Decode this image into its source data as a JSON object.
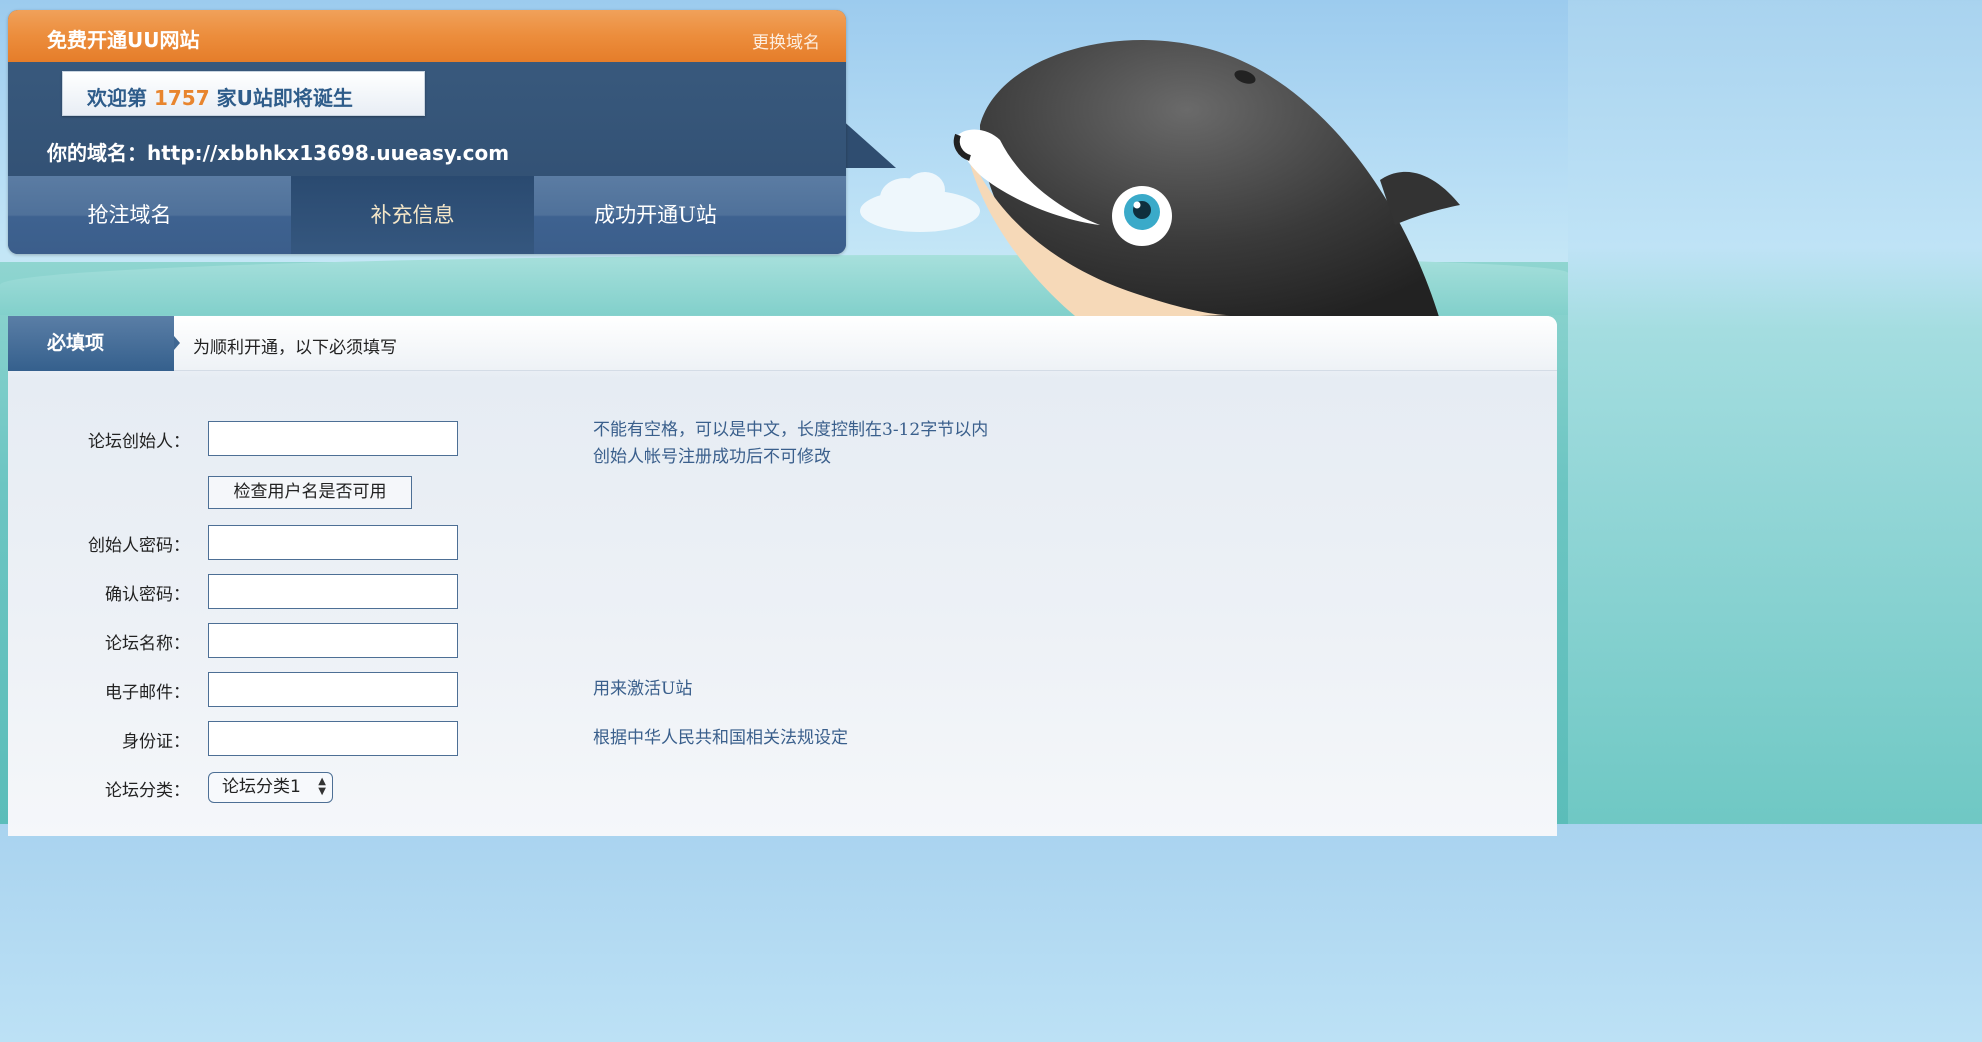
{
  "header": {
    "title": "免费开通UU网站",
    "change_domain": "更换域名",
    "welcome_prefix": "欢迎第 ",
    "welcome_count": "1757",
    "welcome_suffix": " 家U站即将诞生",
    "domain_label": "你的域名：",
    "domain_value": "http://xbbhkx13698.uueasy.com"
  },
  "steps": [
    {
      "label": "抢注域名",
      "active": false
    },
    {
      "label": "补充信息",
      "active": true
    },
    {
      "label": "成功开通U站",
      "active": false
    }
  ],
  "form": {
    "section_tab": "必填项",
    "section_desc": "为顺利开通，以下必须填写",
    "founder_label": "论坛创始人：",
    "founder_value": "",
    "founder_hint_1": "不能有空格，可以是中文，长度控制在3-12字节以内",
    "founder_hint_2": "创始人帐号注册成功后不可修改",
    "check_button": "检查用户名是否可用",
    "password_label": "创始人密码：",
    "password_value": "",
    "confirm_label": "确认密码：",
    "confirm_value": "",
    "forum_name_label": "论坛名称：",
    "forum_name_value": "",
    "email_label": "电子邮件：",
    "email_value": "",
    "email_hint": "用来激活U站",
    "id_label": "身份证：",
    "id_value": "",
    "id_hint": "根据中华人民共和国相关法规设定",
    "category_label": "论坛分类：",
    "category_selected": "论坛分类1"
  },
  "icons": {
    "mascot": "whale-mascot-icon",
    "select_arrows": "up-down-arrows-icon"
  },
  "colors": {
    "accent_orange": "#e8852e",
    "panel_blue": "#2f4d70",
    "link_blue": "#3a5f8c"
  }
}
